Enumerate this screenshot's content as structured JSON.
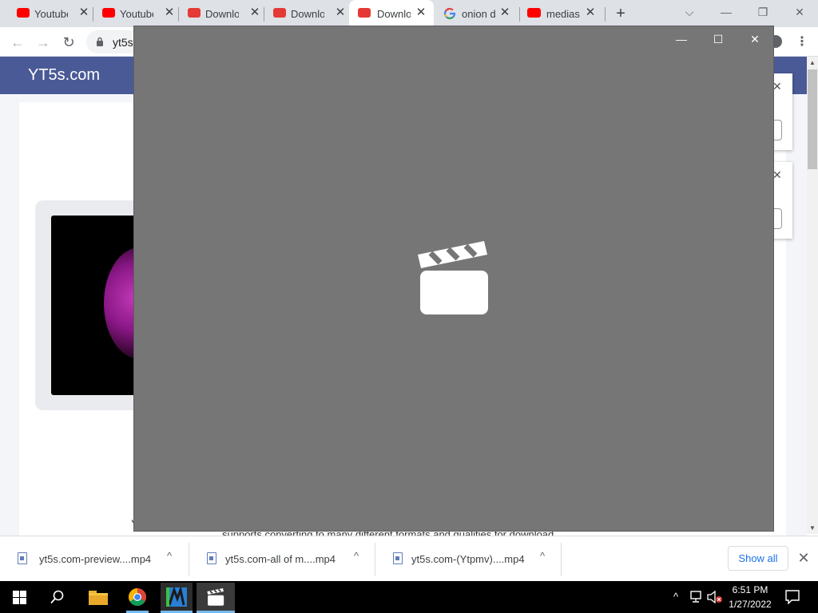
{
  "browser": {
    "tabs": [
      {
        "title": "Youtube",
        "favicon": "youtube-red-icon"
      },
      {
        "title": "Youtube",
        "favicon": "youtube-red-icon"
      },
      {
        "title": "Downlo",
        "favicon": "downloader-icon"
      },
      {
        "title": "Downlo",
        "favicon": "downloader-icon"
      },
      {
        "title": "Downlo",
        "favicon": "downloader-icon",
        "active": true
      },
      {
        "title": "onion d",
        "favicon": "google-icon"
      },
      {
        "title": "medias",
        "favicon": "youtube-icon"
      }
    ],
    "close_glyph": "✕",
    "new_tab_glyph": "+",
    "url": "yt5s",
    "window_controls": {
      "dropdown": "⌵",
      "minimize": "—",
      "restore": "❐",
      "close": "✕"
    }
  },
  "page": {
    "site_name": "YT5s.com",
    "text_fragment": "supports converting to many different formats and qualities for download",
    "text_y": "Y",
    "toast_close": "✕"
  },
  "video_window": {
    "background": "#767676",
    "icon": "clapperboard-icon",
    "controls": {
      "minimize": "—",
      "maximize": "☐",
      "close": "✕"
    }
  },
  "downloads": {
    "items": [
      {
        "filename": "yt5s.com-preview....mp4"
      },
      {
        "filename": "yt5s.com-all of m....mp4"
      },
      {
        "filename": "yt5s.com-(Ytpmv)....mp4"
      }
    ],
    "caret_glyph": "^",
    "show_all": "Show all",
    "close_glyph": "✕"
  },
  "taskbar": {
    "time": "6:51 PM",
    "date": "1/27/2022"
  },
  "colors": {
    "site_header": "#4a5a96",
    "accent_link": "#1a73e8",
    "youtube_red": "#ff0000"
  }
}
